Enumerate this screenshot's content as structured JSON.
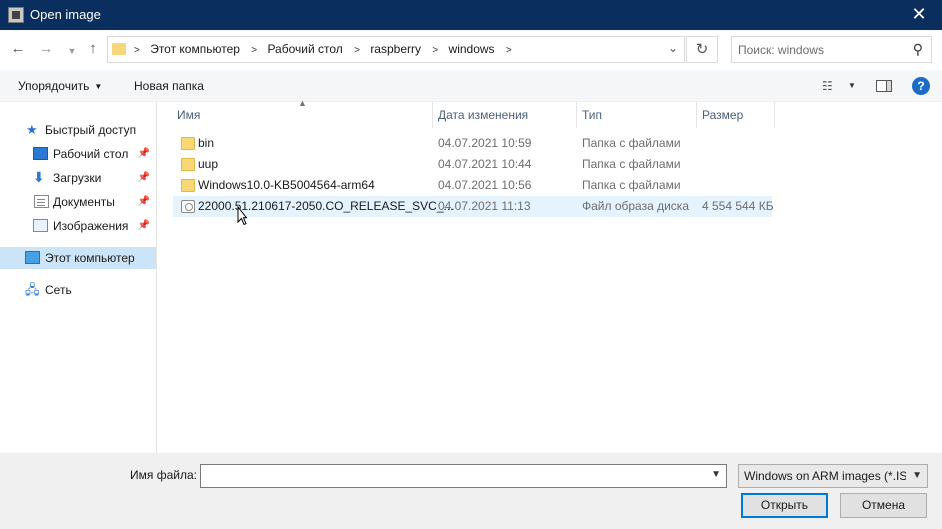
{
  "window": {
    "title": "Open image",
    "close_glyph": "✕"
  },
  "nav": {
    "back_icon": "arrow-left-icon",
    "forward_icon": "arrow-right-icon",
    "recent_icon": "chevron-down-icon",
    "up_icon": "arrow-up-icon",
    "breadcrumbs": [
      "Этот компьютер",
      "Рабочий стол",
      "raspberry",
      "windows"
    ],
    "search_placeholder": "Поиск: windows"
  },
  "toolbar": {
    "organize_label": "Упорядочить",
    "new_folder_label": "Новая папка"
  },
  "sidebar": {
    "items": [
      {
        "label": "Быстрый доступ",
        "icon": "star-icon"
      },
      {
        "label": "Рабочий стол",
        "icon": "desktop-icon",
        "pinned": true
      },
      {
        "label": "Загрузки",
        "icon": "download-icon",
        "pinned": true
      },
      {
        "label": "Документы",
        "icon": "documents-icon",
        "pinned": true
      },
      {
        "label": "Изображения",
        "icon": "pictures-icon",
        "pinned": true
      },
      {
        "label": "Этот компьютер",
        "icon": "computer-icon",
        "selected": true
      },
      {
        "label": "Сеть",
        "icon": "network-icon"
      }
    ]
  },
  "columns": {
    "name": "Имя",
    "date": "Дата изменения",
    "type": "Тип",
    "size": "Размер"
  },
  "files": [
    {
      "name": "bin",
      "date": "04.07.2021 10:59",
      "type": "Папка с файлами",
      "size": "",
      "icon": "folder-icon"
    },
    {
      "name": "uup",
      "date": "04.07.2021 10:44",
      "type": "Папка с файлами",
      "size": "",
      "icon": "folder-icon"
    },
    {
      "name": "Windows10.0-KB5004564-arm64",
      "date": "04.07.2021 10:56",
      "type": "Папка с файлами",
      "size": "",
      "icon": "folder-icon"
    },
    {
      "name": "22000.51.210617-2050.CO_RELEASE_SVC_...",
      "date": "04.07.2021 11:13",
      "type": "Файл образа диска",
      "size": "4 554 544 КБ",
      "icon": "disc-image-icon",
      "hover": true
    }
  ],
  "footer": {
    "filename_label": "Имя файла:",
    "filename_value": "",
    "filter_value": "Windows on ARM images (*.ISO",
    "open_label": "Открыть",
    "cancel_label": "Отмена"
  },
  "colors": {
    "titlebar": "#0a2f5e",
    "selected": "#cce4f7",
    "hover": "#e5f3ff",
    "accent": "#0078d7"
  }
}
